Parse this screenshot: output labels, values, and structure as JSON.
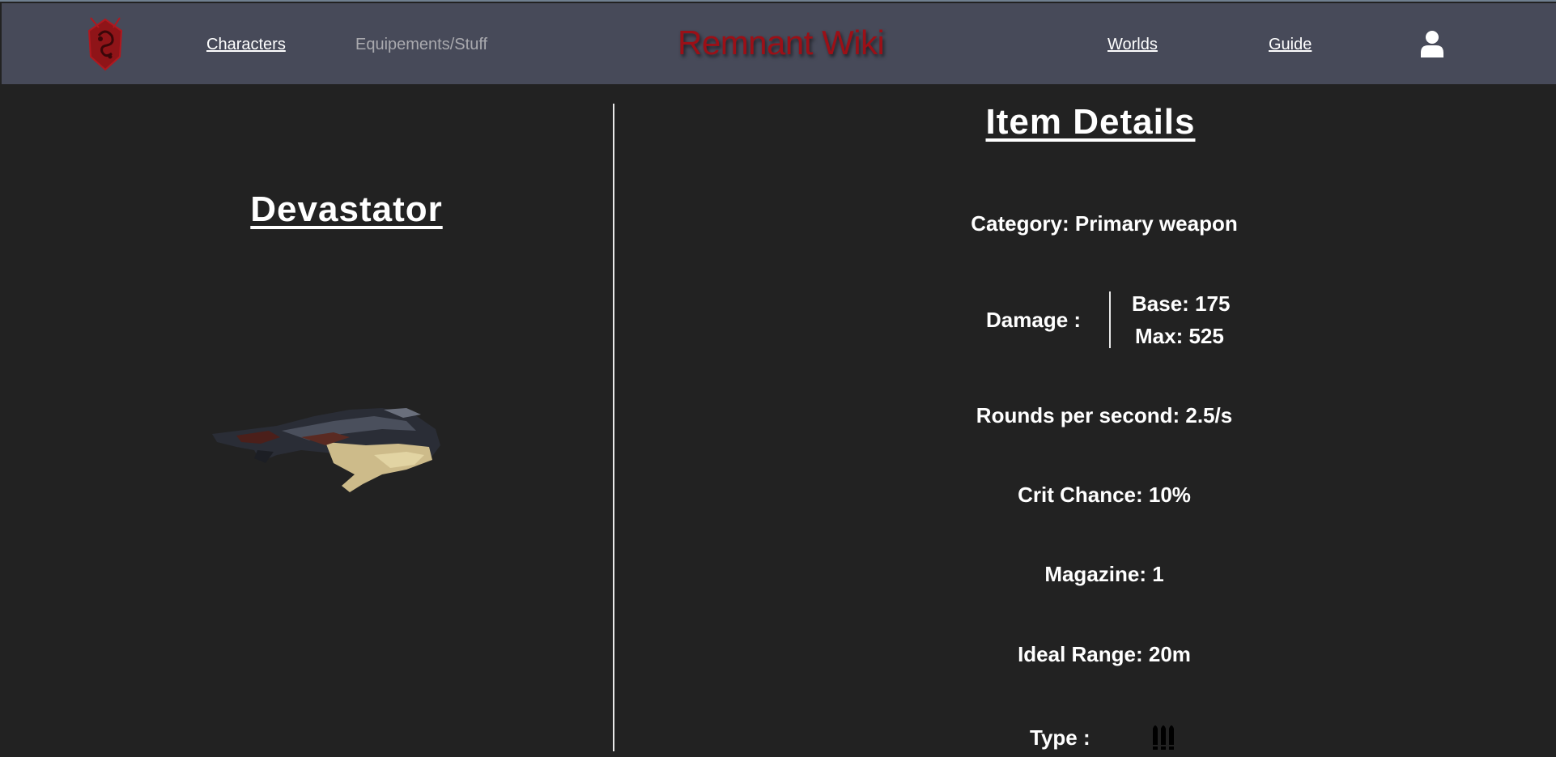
{
  "nav": {
    "links": {
      "characters": "Characters",
      "equipements": "Equipements/Stuff",
      "worlds": "Worlds",
      "guide": "Guide"
    },
    "title": "Remnant Wiki",
    "logo_icon": "remnant-emblem-icon",
    "user_icon": "user-icon"
  },
  "item": {
    "name": "Devastator",
    "image_icon": "devastator-weapon-image"
  },
  "details": {
    "title": "Item Details",
    "category": "Category: Primary weapon",
    "damage_label": "Damage :",
    "damage_base": "Base: 175",
    "damage_max": "Max: 525",
    "rounds": "Rounds per second: 2.5/s",
    "crit": "Crit Chance: 10%",
    "magazine": "Magazine: 1",
    "range": "Ideal Range: 20m",
    "type_label": "Type :",
    "type_icon": "ammo-bullets-icon"
  },
  "colors": {
    "navbar_bg": "#474a59",
    "page_bg": "#222222",
    "title_red": "#9b1017",
    "text": "#ffffff",
    "muted_link": "#a9a9ae"
  }
}
